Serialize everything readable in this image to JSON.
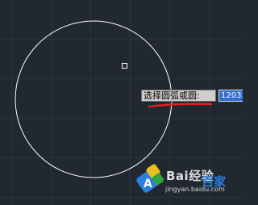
{
  "canvas": {
    "background": "#212830",
    "grid_color": "#2c3540",
    "circle_color": "#ffffff",
    "cursor_box_color": "#ffffff",
    "underline_color": "#e02020"
  },
  "command_prompt": {
    "text": "选择圆弧或圆:"
  },
  "dynamic_input": {
    "value": "1203.3"
  },
  "watermark": {
    "brand": "Bai",
    "brand_suffix": "经验",
    "brand_alt": "百家",
    "url": "jingyan.baidu.com",
    "logo_icon": "baidu-paw-logo-icon"
  }
}
